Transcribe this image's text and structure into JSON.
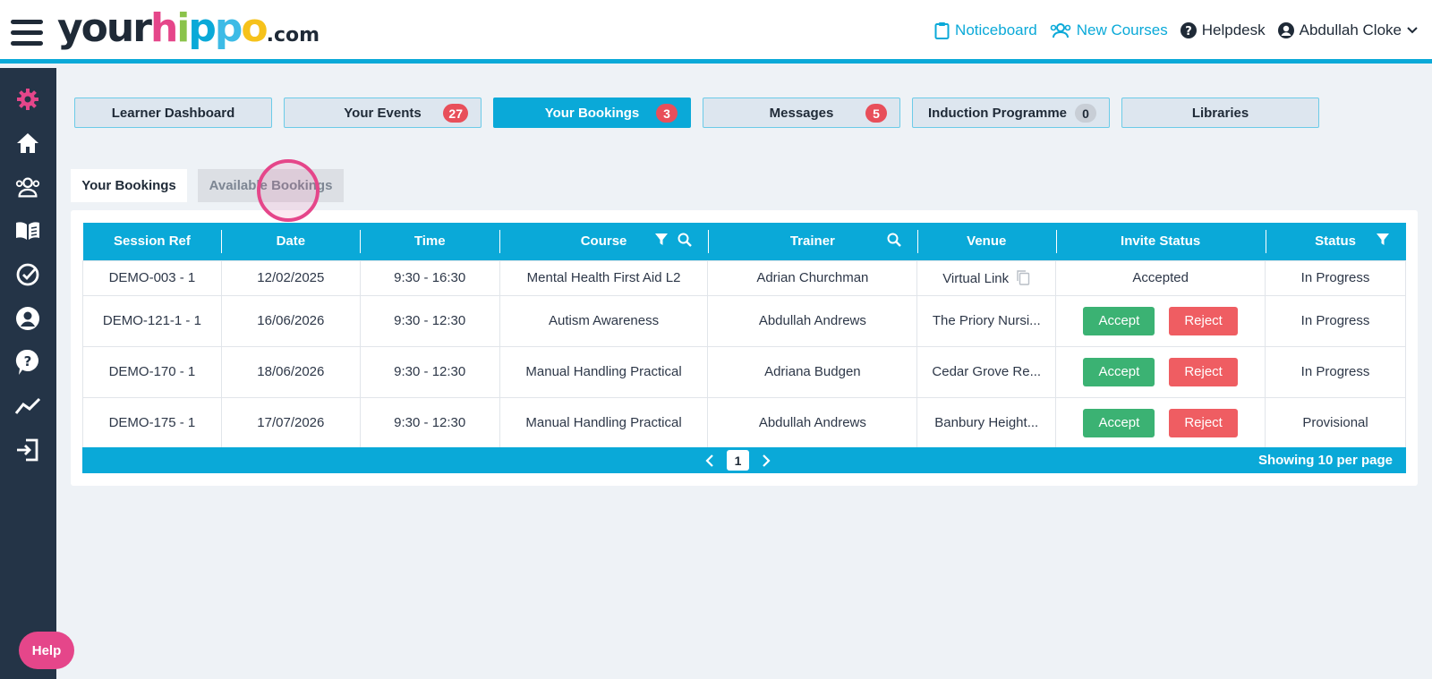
{
  "header": {
    "logo": {
      "your": "your",
      "h": "h",
      "i": "i",
      "p1": "p",
      "p2": "p",
      "o": "o",
      "com": ".com"
    },
    "nav": {
      "noticeboard": "Noticeboard",
      "new_courses": "New Courses",
      "helpdesk": "Helpdesk",
      "user": "Abdullah Cloke"
    }
  },
  "sidebar": {
    "icons": [
      "gear-icon",
      "home-icon",
      "users-icon",
      "book-icon",
      "check-circle-icon",
      "user-circle-icon",
      "help-bubble-icon",
      "trend-icon",
      "logout-icon"
    ],
    "help_label": "Help"
  },
  "top_tabs": [
    {
      "label": "Learner Dashboard",
      "badge": ""
    },
    {
      "label": "Your Events",
      "badge": "27"
    },
    {
      "label": "Your Bookings",
      "badge": "3",
      "active": true
    },
    {
      "label": "Messages",
      "badge": "5"
    },
    {
      "label": "Induction Programme",
      "badge": "0"
    },
    {
      "label": "Libraries",
      "badge": ""
    }
  ],
  "sub_tabs": {
    "active": "Your Bookings",
    "inactive": "Available Bookings"
  },
  "table": {
    "headers": [
      "Session Ref",
      "Date",
      "Time",
      "Course",
      "Trainer",
      "Venue",
      "Invite Status",
      "Status"
    ],
    "rows": [
      {
        "ref": "DEMO-003 - 1",
        "date": "12/02/2025",
        "time": "9:30 - 16:30",
        "course": "Mental Health First Aid L2",
        "trainer": "Adrian Churchman",
        "venue": "Virtual Link",
        "invite": "Accepted",
        "status": "In Progress"
      },
      {
        "ref": "DEMO-121-1 - 1",
        "date": "16/06/2026",
        "time": "9:30 - 12:30",
        "course": "Autism Awareness",
        "trainer": "Abdullah Andrews",
        "venue": "The Priory Nursi...",
        "invite": "",
        "status": "In Progress"
      },
      {
        "ref": "DEMO-170 - 1",
        "date": "18/06/2026",
        "time": "9:30 - 12:30",
        "course": "Manual Handling Practical",
        "trainer": "Adriana Budgen",
        "venue": "Cedar Grove Re...",
        "invite": "",
        "status": "In Progress"
      },
      {
        "ref": "DEMO-175 - 1",
        "date": "17/07/2026",
        "time": "9:30 - 12:30",
        "course": "Manual Handling Practical",
        "trainer": "Abdullah Andrews",
        "venue": "Banbury Height...",
        "invite": "",
        "status": "Provisional"
      }
    ],
    "accept_label": "Accept",
    "reject_label": "Reject"
  },
  "pagination": {
    "current": "1",
    "per_page": "Showing 10 per page"
  },
  "colors": {
    "accent": "#0aa9d8",
    "brand_pink": "#e5468a",
    "sidebar": "#243447",
    "accept": "#3bb273",
    "reject": "#ef5d62"
  }
}
